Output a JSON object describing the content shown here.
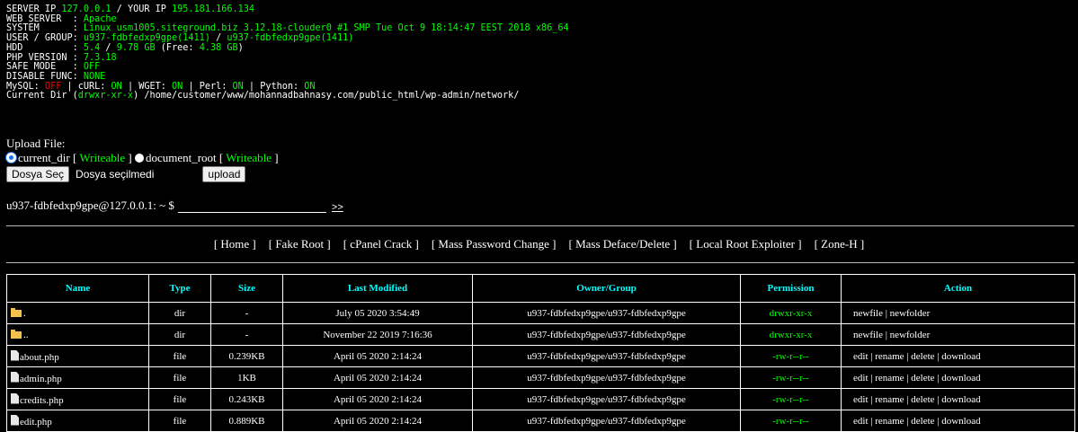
{
  "info": {
    "server_ip_label": "SERVER IP ",
    "server_ip": "127.0.0.1",
    "your_ip_label": " / YOUR IP ",
    "your_ip": "195.181.166.134",
    "web_server_label": "WEB SERVER  : ",
    "web_server": "Apache",
    "system_label": "SYSTEM      : ",
    "system": "Linux usm1005.siteground.biz 3.12.18-clouder0 #1 SMP Tue Oct 9 18:14:47 EEST 2018 x86_64",
    "user_label": "USER / GROUP: ",
    "user": "u937-fdbfedxp9gpe(1411)",
    "user_sep": " / ",
    "group": "u937-fdbfedxp9gpe(1411)",
    "hdd_label": "HDD         : ",
    "hdd_used": "5.4",
    "hdd_sep": " / ",
    "hdd_total": "9.78 GB",
    "hdd_free_label": " (Free: ",
    "hdd_free": "4.38 GB",
    "hdd_free_end": ")",
    "php_label": "PHP VERSION : ",
    "php": "7.3.18",
    "safe_label": "SAFE MODE   : ",
    "safe": "OFF",
    "disable_label": "DISABLE FUNC: ",
    "disable": "NONE",
    "mysql_label": "MySQL: ",
    "mysql": "OFF",
    "curl_label": " | cURL: ",
    "curl": "ON",
    "wget_label": " | WGET: ",
    "wget": "ON",
    "perl_label": " | Perl: ",
    "perl": "ON",
    "python_label": " | Python: ",
    "python": "ON",
    "curdir_label": "Current Dir (",
    "curdir_perm": "drwxr-xr-x",
    "curdir_path": ") /home/customer/www/mohannadbahnasy.com/public_html/wp-admin/network/"
  },
  "upload": {
    "title": "Upload File:",
    "opt1": "current_dir",
    "opt2": "document_root",
    "writeable": "Writeable",
    "open_br": "[ ",
    "close_br": " ]",
    "choose_btn": "Dosya Seç",
    "no_file": "Dosya seçilmedi",
    "upload_btn": "upload"
  },
  "cmd": {
    "prompt": "u937-fdbfedxp9gpe@127.0.0.1: ~ $",
    "go": ">>"
  },
  "menu": [
    "[ Home ]",
    "[ Fake Root ]",
    "[ cPanel Crack ]",
    "[ Mass Password Change ]",
    "[ Mass Deface/Delete ]",
    "[ Local Root Exploiter ]",
    "[ Zone-H ]"
  ],
  "table": {
    "headers": [
      "Name",
      "Type",
      "Size",
      "Last Modified",
      "Owner/Group",
      "Permission",
      "Action"
    ],
    "rows": [
      {
        "name": ".",
        "type": "dir",
        "size": "-",
        "modified": "July 05 2020 3:54:49",
        "owner": "u937-fdbfedxp9gpe/u937-fdbfedxp9gpe",
        "perm": "drwxr-xr-x",
        "action": "newfile | newfolder",
        "icon": "folder-icon"
      },
      {
        "name": "..",
        "type": "dir",
        "size": "-",
        "modified": "November 22 2019 7:16:36",
        "owner": "u937-fdbfedxp9gpe/u937-fdbfedxp9gpe",
        "perm": "drwxr-xr-x",
        "action": "newfile | newfolder",
        "icon": "folder-icon"
      },
      {
        "name": "about.php",
        "type": "file",
        "size": "0.239KB",
        "modified": "April 05 2020 2:14:24",
        "owner": "u937-fdbfedxp9gpe/u937-fdbfedxp9gpe",
        "perm": "-rw-r--r--",
        "action": "edit | rename | delete | download",
        "icon": "file-icon"
      },
      {
        "name": "admin.php",
        "type": "file",
        "size": "1KB",
        "modified": "April 05 2020 2:14:24",
        "owner": "u937-fdbfedxp9gpe/u937-fdbfedxp9gpe",
        "perm": "-rw-r--r--",
        "action": "edit | rename | delete | download",
        "icon": "file-icon"
      },
      {
        "name": "credits.php",
        "type": "file",
        "size": "0.243KB",
        "modified": "April 05 2020 2:14:24",
        "owner": "u937-fdbfedxp9gpe/u937-fdbfedxp9gpe",
        "perm": "-rw-r--r--",
        "action": "edit | rename | delete | download",
        "icon": "file-icon"
      },
      {
        "name": "edit.php",
        "type": "file",
        "size": "0.889KB",
        "modified": "April 05 2020 2:14:24",
        "owner": "u937-fdbfedxp9gpe/u937-fdbfedxp9gpe",
        "perm": "-rw-r--r--",
        "action": "edit | rename | delete | download",
        "icon": "file-icon"
      }
    ]
  }
}
